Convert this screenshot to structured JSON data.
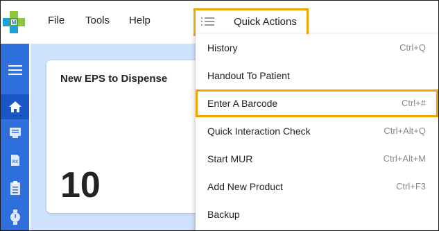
{
  "menu": {
    "file": "File",
    "tools": "Tools",
    "help": "Help"
  },
  "quick_actions": {
    "label": "Quick Actions",
    "items": [
      {
        "label": "History",
        "shortcut": "Ctrl+Q"
      },
      {
        "label": "Handout To Patient",
        "shortcut": ""
      },
      {
        "label": "Enter A Barcode",
        "shortcut": "Ctrl+#"
      },
      {
        "label": "Quick Interaction Check",
        "shortcut": "Ctrl+Alt+Q"
      },
      {
        "label": "Start MUR",
        "shortcut": "Ctrl+Alt+M"
      },
      {
        "label": "Add New Product",
        "shortcut": "Ctrl+F3"
      },
      {
        "label": "Backup",
        "shortcut": ""
      }
    ]
  },
  "card": {
    "title": "New EPS to Dispense",
    "count": "10"
  },
  "sidebar": {
    "icons": [
      "hamburger-icon",
      "home-icon",
      "message-icon",
      "rx-icon",
      "clipboard-icon",
      "watch-icon"
    ]
  },
  "colors": {
    "accent": "#f0a500",
    "sidebar": "#2f6fdc",
    "sidebar_active": "#1a56c4",
    "content_bg": "#cfe2fb"
  }
}
